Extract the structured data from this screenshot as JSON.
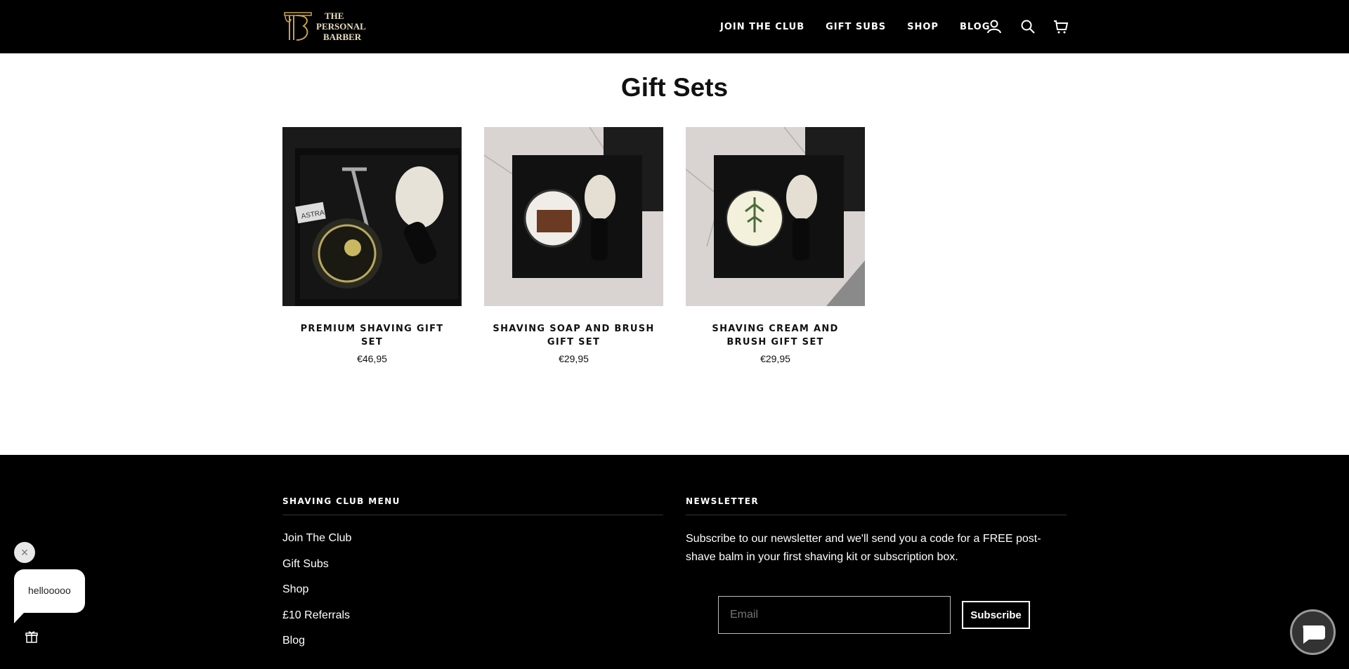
{
  "header": {
    "logo_lines": [
      "THE",
      "PERSONAL",
      "BARBER"
    ],
    "nav": [
      {
        "label": "JOIN THE CLUB"
      },
      {
        "label": "GIFT SUBS"
      },
      {
        "label": "SHOP"
      },
      {
        "label": "BLOG"
      }
    ],
    "icons": [
      "account-icon",
      "search-icon",
      "cart-icon"
    ]
  },
  "page": {
    "title": "Gift Sets"
  },
  "products": [
    {
      "name": "PREMIUM SHAVING GIFT SET",
      "price": "€46,95"
    },
    {
      "name": "SHAVING SOAP AND BRUSH GIFT SET",
      "price": "€29,95"
    },
    {
      "name": "SHAVING CREAM AND BRUSH GIFT SET",
      "price": "€29,95"
    }
  ],
  "footer": {
    "menu_heading": "SHAVING CLUB MENU",
    "menu_links": [
      "Join The Club",
      "Gift Subs",
      "Shop",
      "£10 Referrals",
      "Blog"
    ],
    "newsletter_heading": "NEWSLETTER",
    "newsletter_text": "Subscribe to our newsletter and we'll send you a code for a FREE post-shave balm in your first shaving kit or subscription box.",
    "email_placeholder": "Email",
    "subscribe_label": "Subscribe"
  },
  "chat": {
    "bubble_text": "hellooooo",
    "close_symbol": "×"
  },
  "colors": {
    "header_bg": "#000000",
    "logo_gold": "#c9a24a",
    "footer_bg": "#000000"
  }
}
